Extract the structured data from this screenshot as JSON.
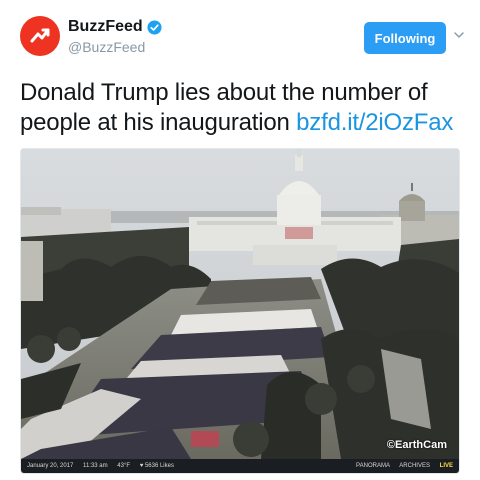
{
  "account": {
    "display_name": "BuzzFeed",
    "handle": "@BuzzFeed",
    "avatar_icon": "buzzfeed-logo-icon",
    "verified_icon": "verified-badge-icon",
    "brand_color": "#ee3322"
  },
  "follow_button": {
    "label": "Following",
    "color": "#2b9df4"
  },
  "menu_caret_icon": "chevron-down-icon",
  "tweet": {
    "text": "Donald Trump lies about the number of people at his inauguration ",
    "link": "bzfd.it/2iOzFax",
    "link_color": "#1b95e0"
  },
  "media": {
    "watermark": "EarthCam",
    "cam_bar": {
      "date": "January 20, 2017",
      "time": "11:33 am",
      "temp": "43°F",
      "likes": "♥ 5636 Likes",
      "panorama": "PANORAMA",
      "archives": "ARCHIVES",
      "live": "LIVE"
    }
  }
}
